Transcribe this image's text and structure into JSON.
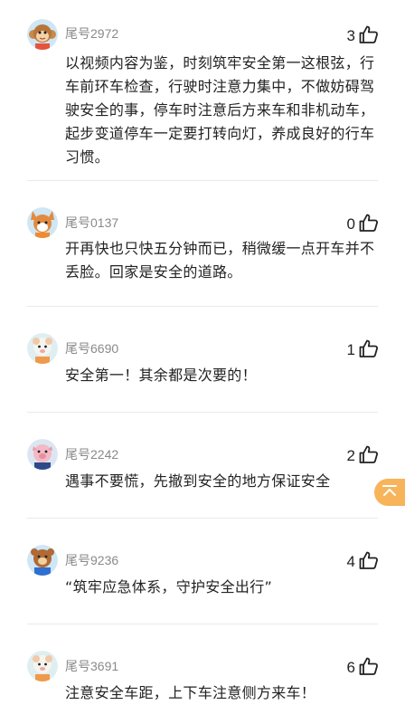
{
  "comments": [
    {
      "user": "尾号2972",
      "likes": "3",
      "text": "以视频内容为鉴，时刻筑牢安全第一这根弦，行车前环车检查，行驶时注意力集中，不做妨碍驾驶安全的事，停车时注意后方来车和非机动车，起步变道停车一定要打转向灯，养成良好的行车习惯。",
      "avatar": "monkey"
    },
    {
      "user": "尾号0137",
      "likes": "0",
      "text": "开再快也只快五分钟而已，稍微缓一点开车并不丢脸。回家是安全的道路。",
      "avatar": "fox"
    },
    {
      "user": "尾号6690",
      "likes": "1",
      "text": "安全第一！其余都是次要的！",
      "avatar": "sheep"
    },
    {
      "user": "尾号2242",
      "likes": "2",
      "text": "遇事不要慌，先撤到安全的地方保证安全",
      "avatar": "pig"
    },
    {
      "user": "尾号9236",
      "likes": "4",
      "text": "“筑牢应急体系，守护安全出行”",
      "avatar": "bear"
    },
    {
      "user": "尾号3691",
      "likes": "6",
      "text": "注意安全车距，上下车注意侧方来车！",
      "avatar": "sheep"
    }
  ],
  "icons": {
    "like": "thumbs-up-icon",
    "float": "chevron-up-icon"
  },
  "colors": {
    "accent": "#f7b45a",
    "text": "#222222",
    "muted": "#8a8a8a"
  }
}
